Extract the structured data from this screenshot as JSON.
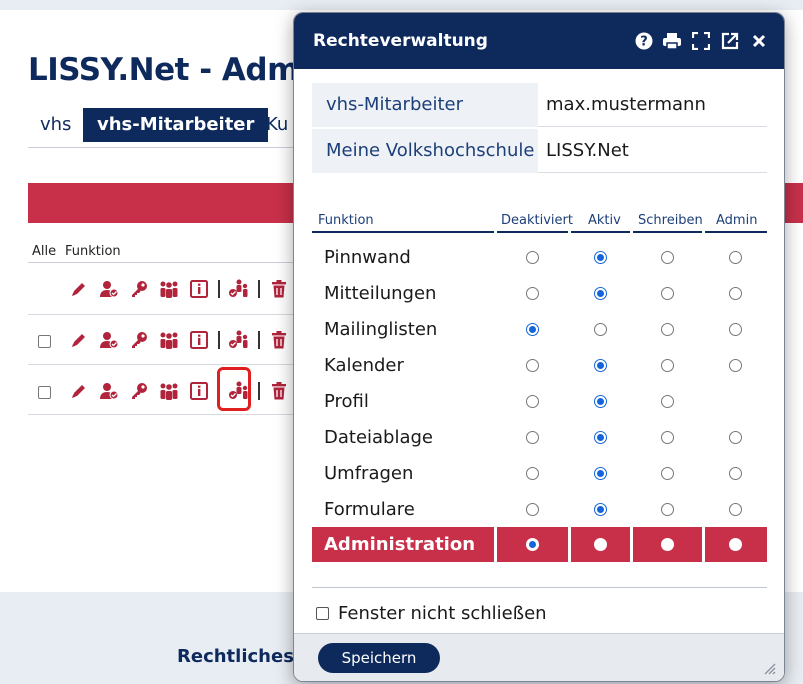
{
  "background": {
    "app_title": "LISSY.Net - Admi",
    "tabs": [
      {
        "label": "vhs",
        "active": false
      },
      {
        "label": "vhs-Mitarbeiter",
        "active": true
      },
      {
        "label": "Ku",
        "active": false
      }
    ],
    "list_headers": {
      "all": "Alle",
      "function": "Funktion"
    },
    "row_icons": [
      "pencil-icon",
      "user-check-icon",
      "key-icon",
      "group-icon",
      "info-icon",
      "rights-icon",
      "trash-icon"
    ],
    "footer_link": "Rechtliches"
  },
  "dialog": {
    "title": "Rechteverwaltung",
    "header_icons": [
      "help-icon",
      "print-icon",
      "fullscreen-icon",
      "popout-icon",
      "close-icon"
    ],
    "info": [
      {
        "label": "vhs-Mitarbeiter",
        "value": "max.mustermann"
      },
      {
        "label": "Meine Volkshochschule",
        "value": "LISSY.Net"
      }
    ],
    "columns": [
      "Funktion",
      "Deaktiviert",
      "Aktiv",
      "Schreiben",
      "Admin"
    ],
    "permissions": [
      {
        "name": "Pinnwand",
        "options": 4,
        "selected": 1
      },
      {
        "name": "Mitteilungen",
        "options": 4,
        "selected": 1
      },
      {
        "name": "Mailinglisten",
        "options": 4,
        "selected": 0
      },
      {
        "name": "Kalender",
        "options": 4,
        "selected": 1
      },
      {
        "name": "Profil",
        "options": 3,
        "selected": 1
      },
      {
        "name": "Dateiablage",
        "options": 4,
        "selected": 1
      },
      {
        "name": "Umfragen",
        "options": 4,
        "selected": 1
      },
      {
        "name": "Formulare",
        "options": 4,
        "selected": 1
      },
      {
        "name": "Administration",
        "options": 4,
        "selected": 0,
        "highlighted": true
      }
    ],
    "keep_open_label": "Fenster nicht schließen",
    "keep_open_checked": false,
    "save_label": "Speichern"
  },
  "colors": {
    "primary": "#0e2a5c",
    "accent_red": "#c8304a",
    "radio_blue": "#1565d8"
  }
}
